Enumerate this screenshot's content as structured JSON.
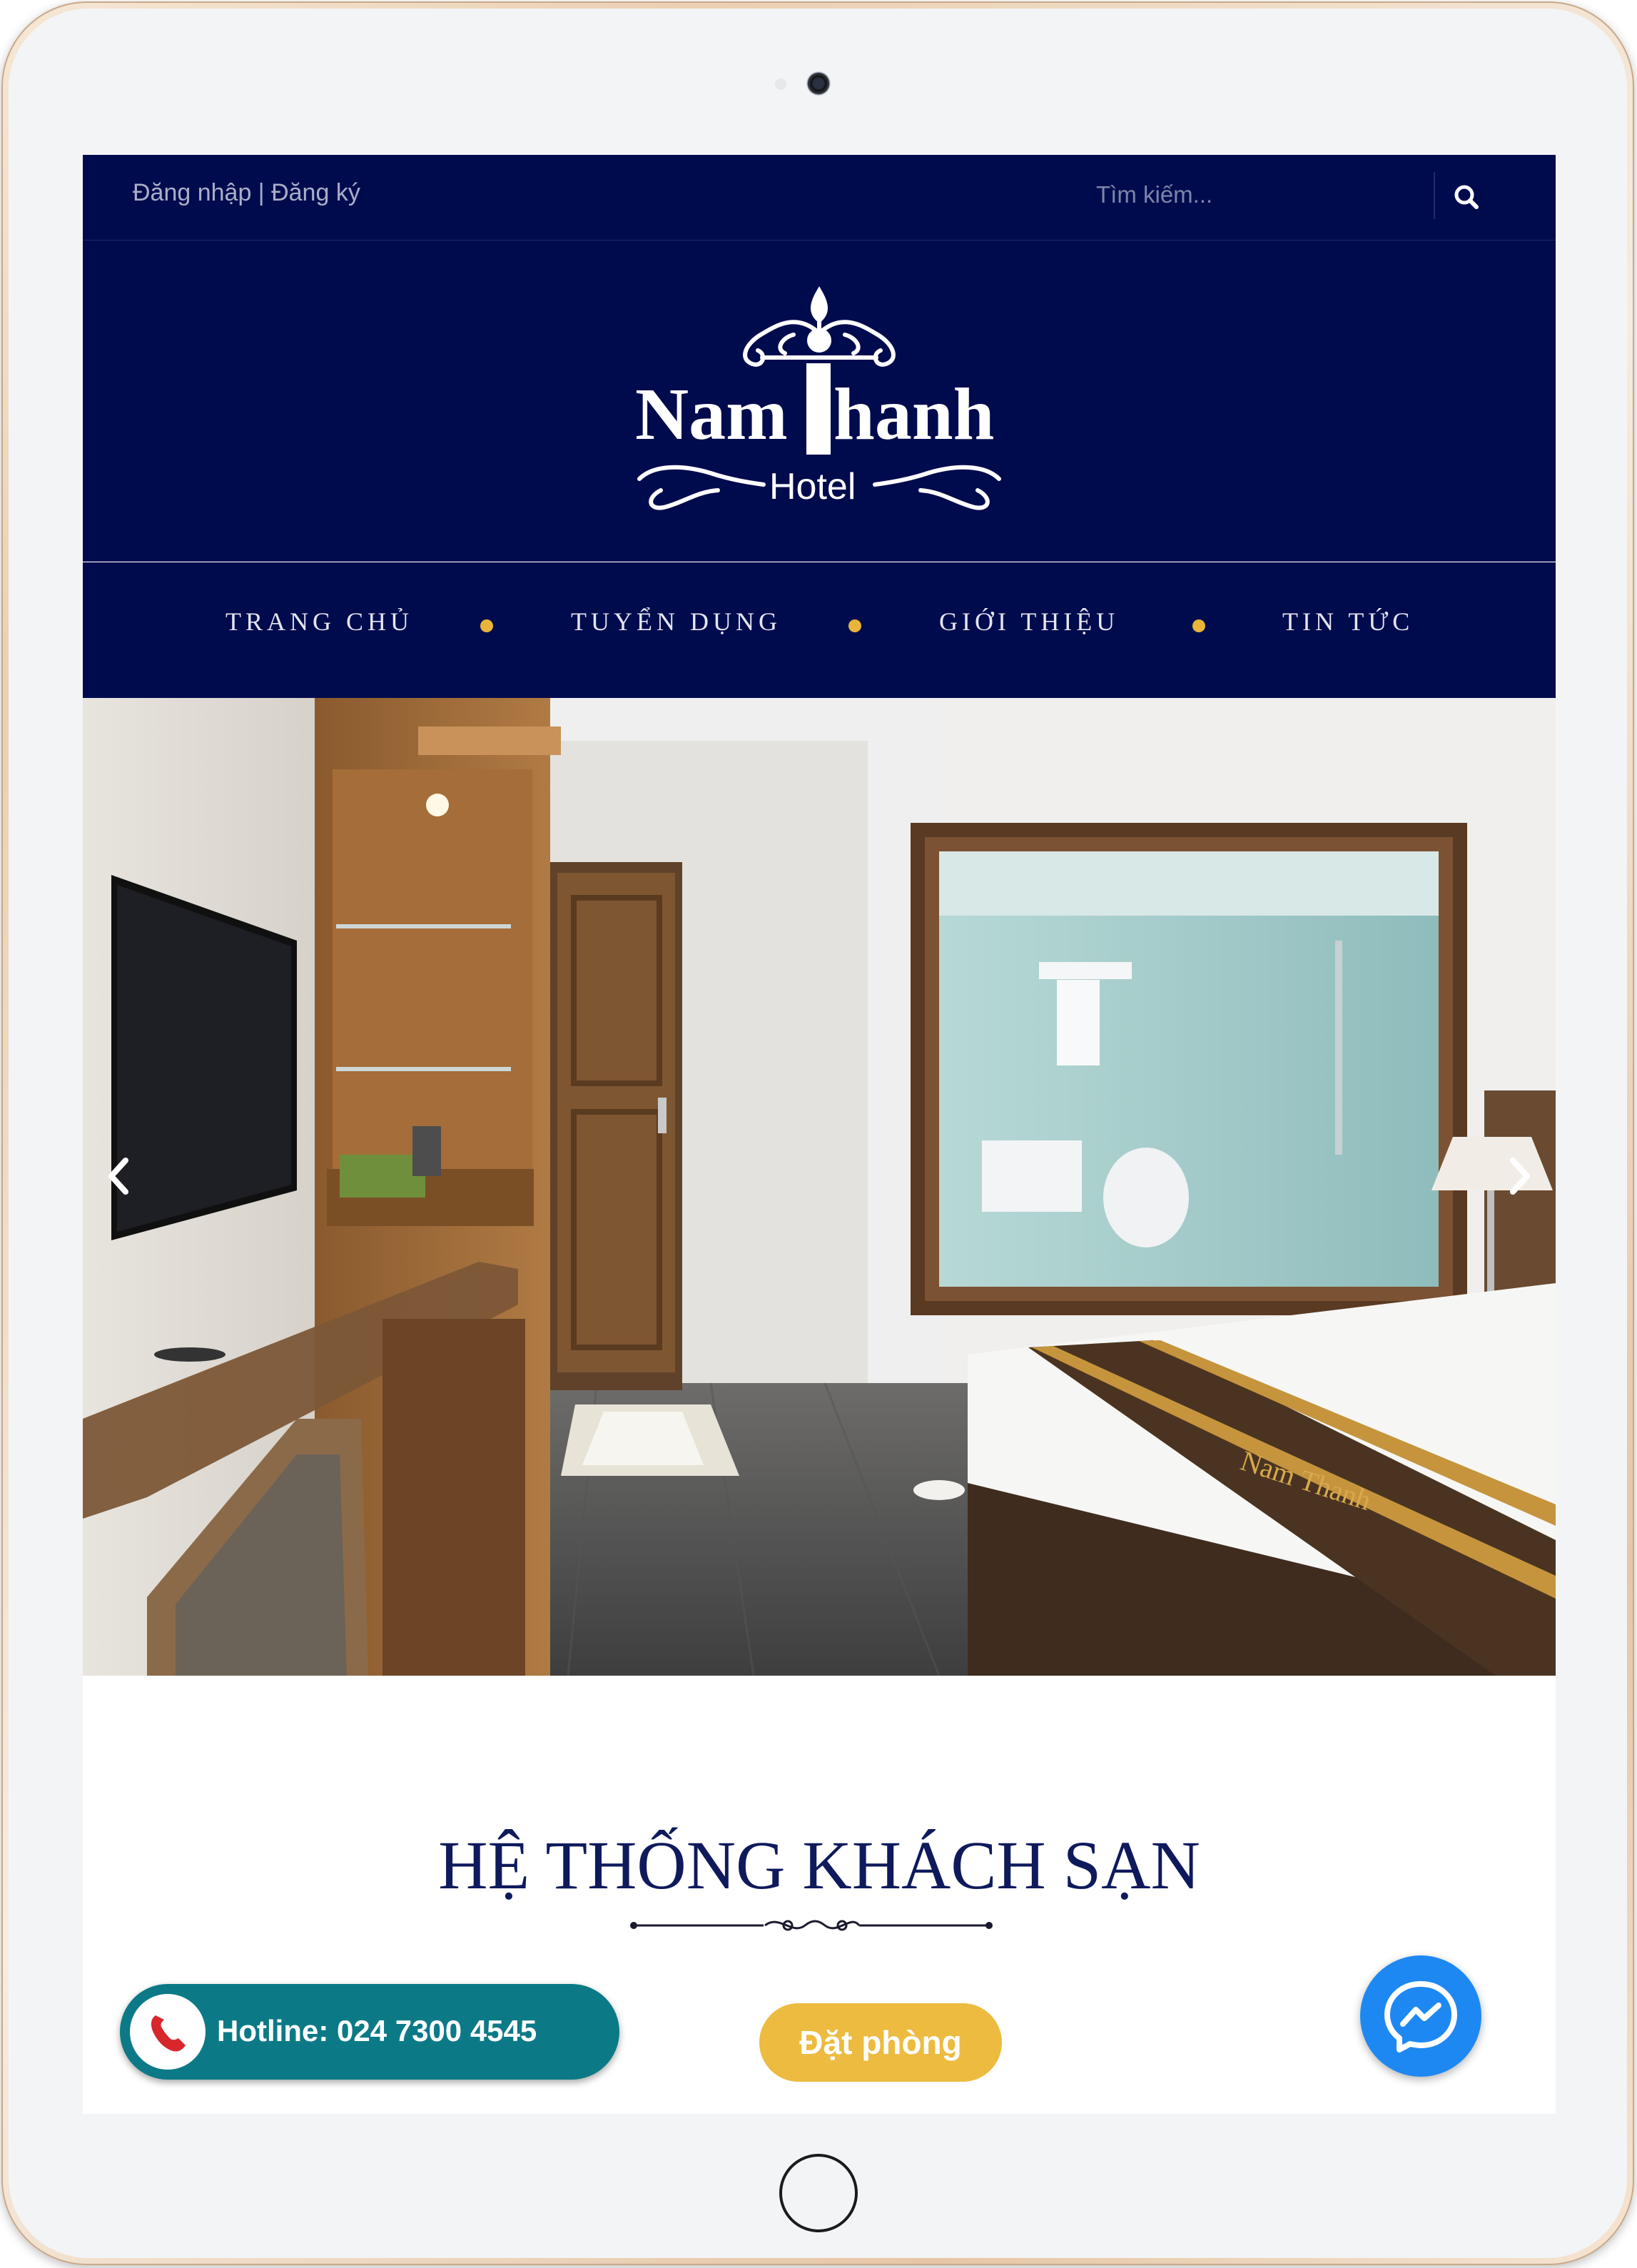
{
  "header": {
    "auth_text": "Đăng nhập | Đăng ký",
    "search_placeholder": "Tìm kiếm..."
  },
  "logo": {
    "name_text": "Nam Thanh",
    "sub_text": "Hotel"
  },
  "nav": {
    "items": [
      {
        "label": "TRANG CHỦ"
      },
      {
        "label": "TUYỂN DỤNG"
      },
      {
        "label": "GIỚI THIỆU"
      },
      {
        "label": "TIN TỨC"
      }
    ]
  },
  "hero": {
    "image_description": "hotel room"
  },
  "section": {
    "title": "HỆ THỐNG KHÁCH SẠN"
  },
  "floating": {
    "hotline_label": "Hotline: 024 7300 4545",
    "book_label": "Đặt phòng"
  },
  "colors": {
    "brand_navy": "#000b4d",
    "accent_gold": "#e9b43a",
    "hotline_teal": "#0c7a86",
    "messenger_blue": "#1e88f2"
  },
  "icons": [
    "search-icon",
    "phone-icon",
    "messenger-icon",
    "chevron-left-icon",
    "chevron-right-icon"
  ]
}
